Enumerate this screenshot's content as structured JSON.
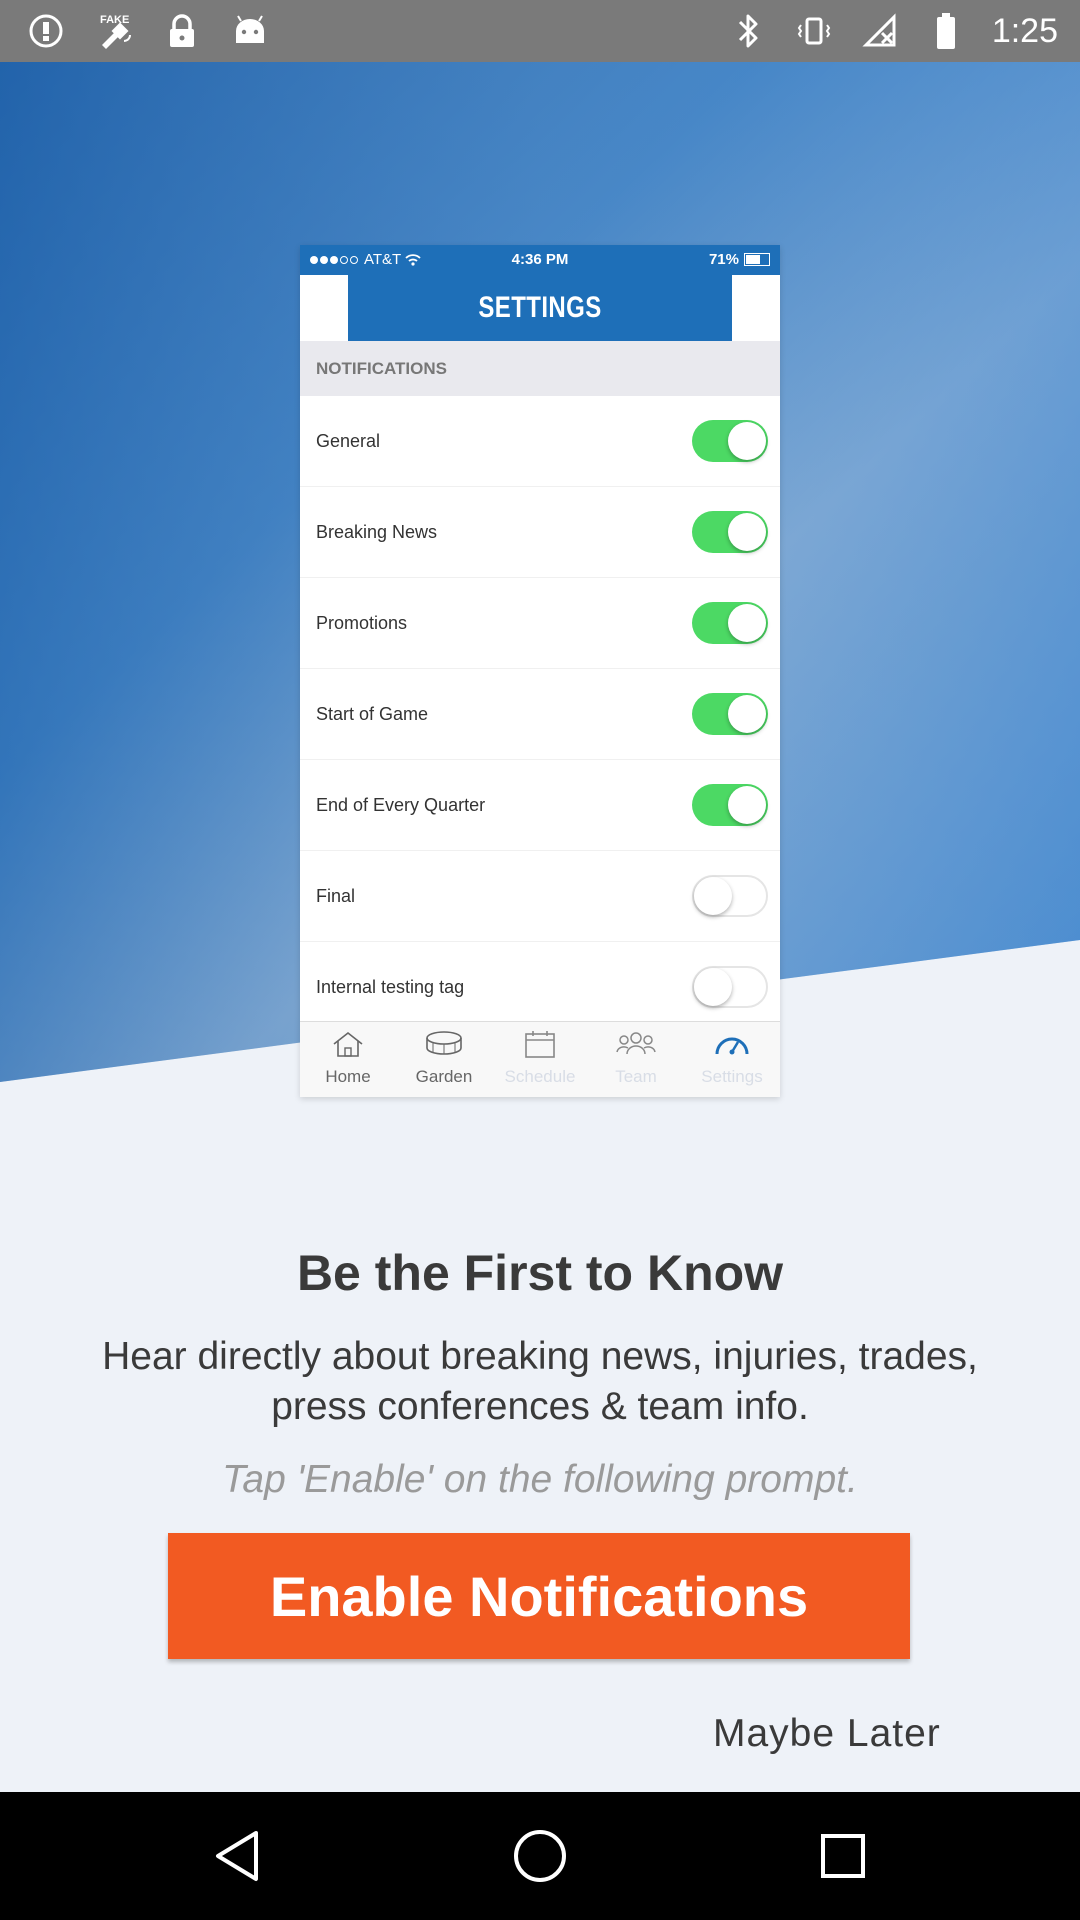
{
  "status_bar": {
    "time": "1:25",
    "left_icons": [
      "alert-icon",
      "fake-gps-icon",
      "lock-icon",
      "android-icon"
    ],
    "right_icons": [
      "bluetooth-icon"
    ]
  },
  "embedded_screenshot": {
    "carrier": "AT&T",
    "time": "4:36 PM",
    "battery": "71%",
    "header_title": "SETTINGS",
    "section_title": "NOTIFICATIONS",
    "rows": [
      {
        "label": "General",
        "on": true
      },
      {
        "label": "Breaking News",
        "on": true
      },
      {
        "label": "Promotions",
        "on": true
      },
      {
        "label": "Start of Game",
        "on": true
      },
      {
        "label": "End of Every Quarter",
        "on": true
      },
      {
        "label": "Final",
        "on": false
      },
      {
        "label": "Internal testing tag",
        "on": false
      }
    ],
    "tabs": [
      {
        "label": "Home",
        "icon": "home-icon"
      },
      {
        "label": "Garden",
        "icon": "arena-icon"
      },
      {
        "label": "Schedule",
        "icon": "calendar-icon"
      },
      {
        "label": "Team",
        "icon": "team-icon"
      },
      {
        "label": "Settings",
        "icon": "gauge-icon"
      }
    ]
  },
  "content": {
    "title": "Be the First to Know",
    "subtitle": "Hear directly about breaking news, injuries, trades, press conferences & team info.",
    "hint": "Tap 'Enable' on the following prompt.",
    "enable_button": "Enable Notifications",
    "later_link": "Maybe Later"
  },
  "colors": {
    "accent": "#f25a22",
    "header_blue": "#1e6fb8",
    "toggle_on": "#4cd964"
  },
  "nav_bar": [
    "back-icon",
    "home-icon",
    "recents-icon"
  ]
}
